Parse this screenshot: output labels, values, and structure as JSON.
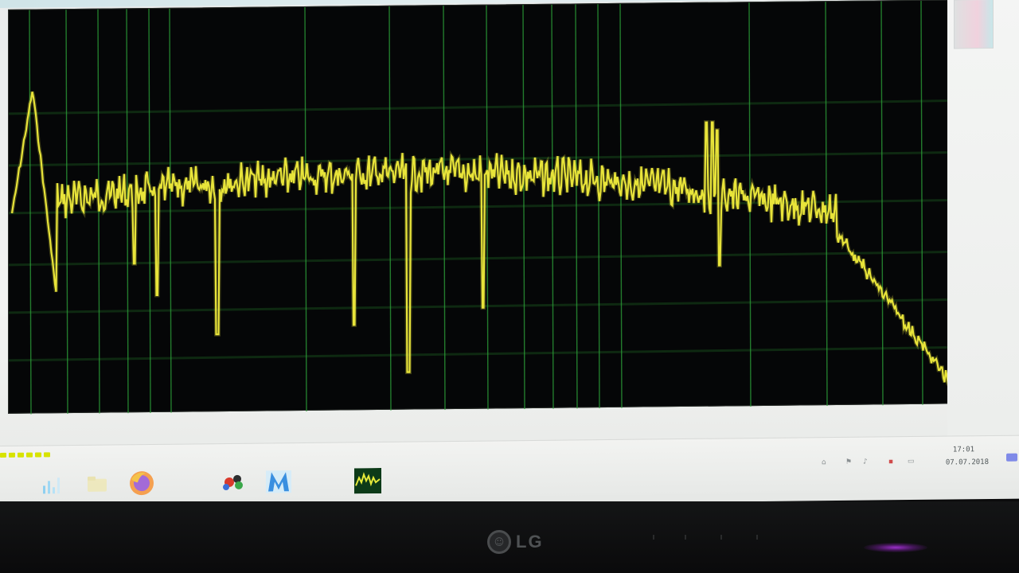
{
  "window": {
    "title": ""
  },
  "spectrum": {
    "trace_color": "#e8e43a",
    "grid_color": "#1f6b24",
    "background_color": "#050607"
  },
  "freq_axis": {
    "ticks": [
      "",
      "",
      "",
      "",
      "",
      ""
    ]
  },
  "taskbar": {
    "start_label": "",
    "apps": [
      {
        "icon": "audio-meter-icon"
      },
      {
        "icon": "firefox-icon"
      },
      {
        "icon": "paint-palette-icon"
      },
      {
        "icon": "m-app-icon"
      },
      {
        "icon": "spectrum-analyzer-icon"
      }
    ],
    "clock": {
      "time": "17:01",
      "date": "07.07.2018"
    }
  },
  "monitor": {
    "brand": "LG"
  }
}
